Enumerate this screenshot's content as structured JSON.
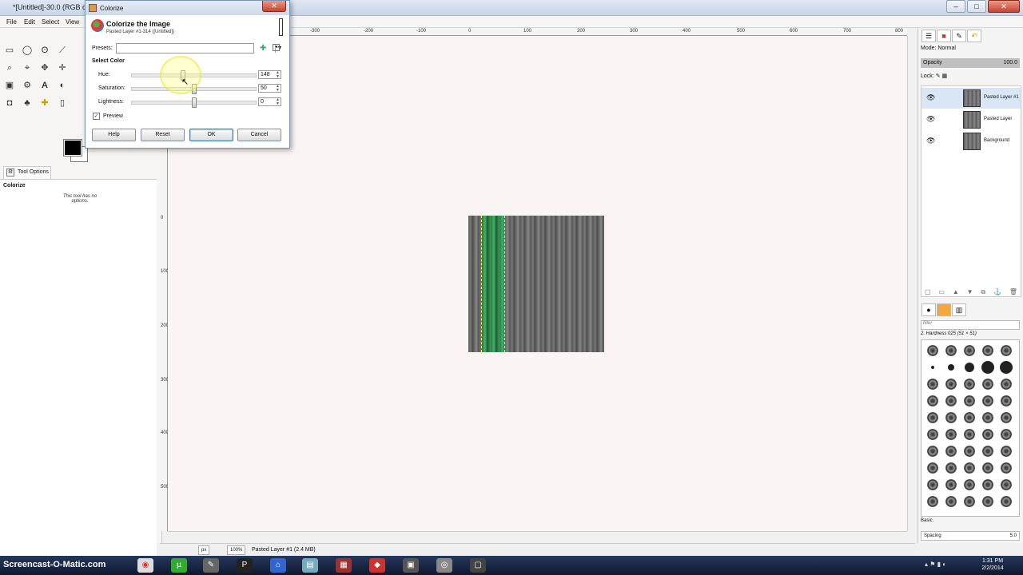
{
  "main_window": {
    "title": "*[Untitled]-30.0 (RGB co",
    "menu": [
      "File",
      "Edit",
      "Select",
      "View"
    ]
  },
  "tool_options": {
    "tab_label": "Tool Options",
    "tool_name": "Colorize",
    "no_options_text": "This tool has no options."
  },
  "rulers": {
    "top_labels": [
      "-300",
      "-200",
      "-100",
      "0",
      "100",
      "200",
      "300",
      "400",
      "500",
      "600",
      "700",
      "800"
    ],
    "left_labels": [
      "0",
      "100",
      "200",
      "300",
      "400",
      "500"
    ]
  },
  "status": {
    "unit": "px",
    "zoom": "100%",
    "layer_info": "Pasted Layer #1 (2.4 MB)"
  },
  "layers_dock": {
    "mode_label": "Mode: Normal",
    "opacity_label": "Opacity",
    "opacity_value": "100.0",
    "lock_label": "Lock:",
    "layers": [
      {
        "name": "Pasted Layer #1"
      },
      {
        "name": "Pasted Layer"
      },
      {
        "name": "Background"
      }
    ]
  },
  "brushes_dock": {
    "filter_placeholder": "filter",
    "brush_name": "2. Hardness 025 (51 × 51)",
    "preset": "Basic.",
    "spacing_label": "Spacing",
    "spacing_value": "5.0"
  },
  "dialog": {
    "window_title": "Colorize",
    "heading": "Colorize the Image",
    "subheading": "Pasted Layer #1-314 ([Untitled])",
    "presets_label": "Presets:",
    "presets_value": "",
    "section_label": "Select Color",
    "sliders": [
      {
        "label": "Hue:",
        "value": "148",
        "fraction": 0.411
      },
      {
        "label": "Saturation:",
        "value": "50",
        "fraction": 0.5
      },
      {
        "label": "Lightness:",
        "value": "0",
        "fraction": 0.5
      }
    ],
    "preview_label": "Preview",
    "preview_checked": true,
    "buttons": {
      "help": "Help",
      "reset": "Reset",
      "ok": "OK",
      "cancel": "Cancel"
    }
  },
  "taskbar": {
    "watermark": "Screencast-O-Matic.com",
    "time": "1:31 PM",
    "date": "2/2/2014"
  },
  "colors": {
    "accent": "#3c7fb1",
    "selection_green": "#46b36a"
  }
}
